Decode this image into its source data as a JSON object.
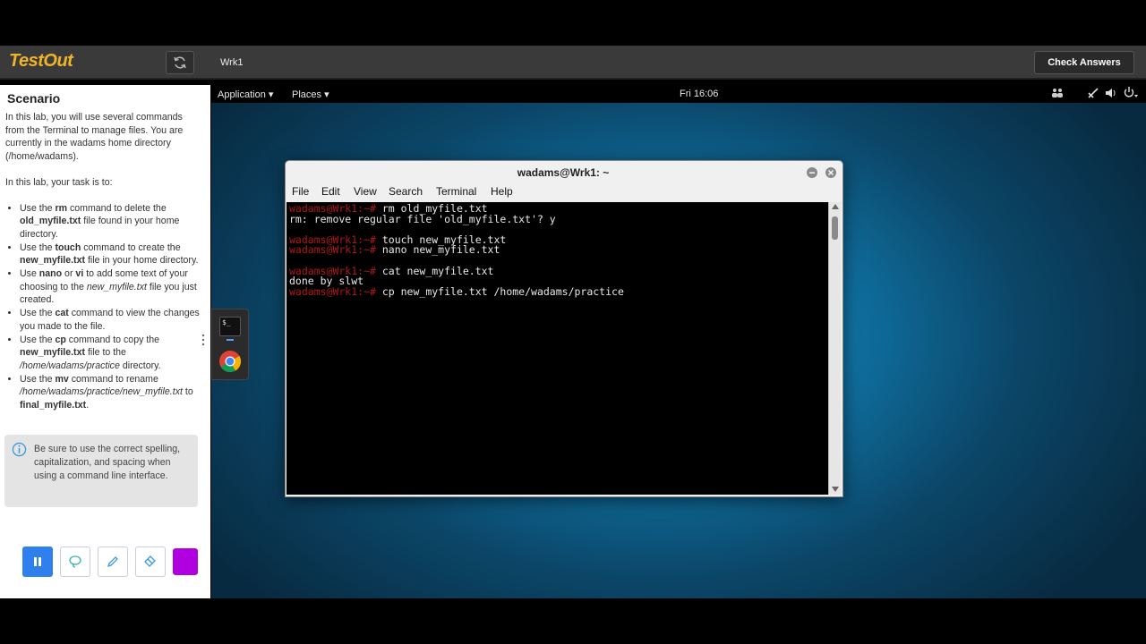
{
  "app": {
    "logo": "TestOut",
    "machine": "Wrk1",
    "check_answers": "Check Answers"
  },
  "scenario": {
    "title": "Scenario",
    "intro": "In this lab, you will use several commands from the Terminal to manage files. You are currently in the wadams home directory (/home/wadams).",
    "task_intro": "In this lab, your task is to:",
    "tasks": {
      "t1": {
        "a": "Use the ",
        "b": "rm",
        "c": " command to delete the ",
        "d": "old_myfile.txt",
        "e": " file found in your home directory."
      },
      "t2": {
        "a": "Use the ",
        "b": "touch",
        "c": " command to create the ",
        "d": "new_myfile.txt",
        "e": " file in your home directory."
      },
      "t3": {
        "a": "Use ",
        "b": "nano",
        "c": " or ",
        "d": "vi",
        "e": " to add some text of your choosing to the ",
        "f": "new_myfile.txt",
        "g": " file you just created."
      },
      "t4": {
        "a": "Use the ",
        "b": "cat",
        "c": " command to view the changes you made to the file."
      },
      "t5": {
        "a": "Use the ",
        "b": "cp",
        "c": " command to copy the ",
        "d": "new_myfile.txt",
        "e": " file to the ",
        "f": "/home/wadams/practice",
        "g": " directory."
      },
      "t6": {
        "a": "Use the ",
        "b": "mv",
        "c": " command to rename ",
        "d": "/home/wadams/practice/new_myfile.txt",
        "e": " to ",
        "f": "final_myfile.txt",
        "g": "."
      }
    },
    "note": "Be sure to use the correct spelling, capitalization, and spacing when using a command line interface."
  },
  "tools": {
    "pause": "pause-icon",
    "lasso": "lasso-icon",
    "pen": "pencil-icon",
    "eraser": "eraser-icon",
    "color": "#b000e0"
  },
  "desktop": {
    "menu_application": "Application ▾",
    "menu_places": "Places ▾",
    "clock": "Fri 16:06"
  },
  "terminal": {
    "title": "wadams@Wrk1: ~",
    "menu": [
      "File",
      "Edit",
      "View",
      "Search",
      "Terminal",
      "Help"
    ],
    "prompt": "wadams@Wrk1:~#",
    "lines": {
      "l1": " rm old_myfile.txt",
      "l2": "rm: remove regular file 'old_myfile.txt'? y",
      "l3": " touch new_myfile.txt",
      "l4": " nano new_myfile.txt",
      "l5": " cat new_myfile.txt",
      "l6": "done by slwt",
      "l7": " cp new_myfile.txt /home/wadams/practice"
    }
  }
}
